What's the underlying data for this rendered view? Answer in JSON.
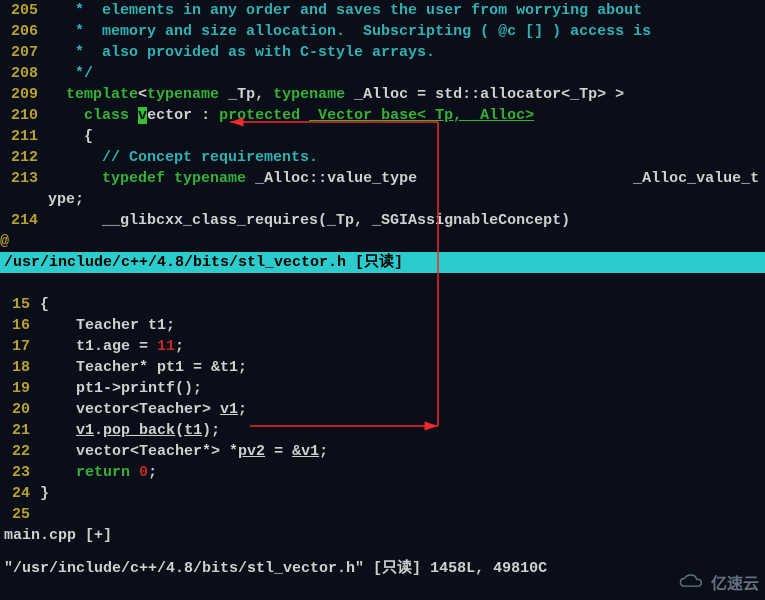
{
  "upper_pane": {
    "lines": [
      {
        "num": "205",
        "segments": [
          {
            "cls": "comment",
            "t": "   *  elements in any order and saves the user from worrying about"
          }
        ]
      },
      {
        "num": "206",
        "segments": [
          {
            "cls": "comment",
            "t": "   *  memory and size allocation.  Subscripting ( @c [] ) access is"
          }
        ]
      },
      {
        "num": "207",
        "segments": [
          {
            "cls": "comment",
            "t": "   *  also provided as with C-style arrays."
          }
        ]
      },
      {
        "num": "208",
        "segments": [
          {
            "cls": "comment",
            "t": "   */"
          }
        ]
      },
      {
        "num": "209",
        "segments": [
          {
            "cls": "plain",
            "t": "  "
          },
          {
            "cls": "keyword",
            "t": "template"
          },
          {
            "cls": "plain",
            "t": "<"
          },
          {
            "cls": "keyword",
            "t": "typename"
          },
          {
            "cls": "plain",
            "t": " _Tp, "
          },
          {
            "cls": "keyword",
            "t": "typename"
          },
          {
            "cls": "plain",
            "t": " _Alloc = std::allocator<_Tp> >"
          }
        ]
      },
      {
        "num": "210",
        "segments": [
          {
            "cls": "plain",
            "t": "    "
          },
          {
            "cls": "keyword",
            "t": "class"
          },
          {
            "cls": "plain",
            "t": " "
          },
          {
            "cls": "cursor",
            "t": "v"
          },
          {
            "cls": "plain",
            "t": "ector : "
          },
          {
            "cls": "protected-kw",
            "t": "protected"
          },
          {
            "cls": "plain",
            "t": " "
          },
          {
            "cls": "type",
            "t": "_Vector_base<_Tp, _Alloc>"
          }
        ]
      },
      {
        "num": "211",
        "segments": [
          {
            "cls": "plain",
            "t": "    {"
          }
        ]
      },
      {
        "num": "212",
        "segments": [
          {
            "cls": "plain",
            "t": "      "
          },
          {
            "cls": "comment",
            "t": "// Concept requirements."
          }
        ]
      },
      {
        "num": "213",
        "segments": [
          {
            "cls": "plain",
            "t": "      "
          },
          {
            "cls": "keyword",
            "t": "typedef"
          },
          {
            "cls": "plain",
            "t": " "
          },
          {
            "cls": "keyword",
            "t": "typename"
          },
          {
            "cls": "plain",
            "t": " _Alloc::value_type                        _Alloc_value_t"
          }
        ]
      },
      {
        "num": "",
        "segments": [
          {
            "cls": "plain",
            "t": "ype;"
          }
        ],
        "continuation": true
      },
      {
        "num": "214",
        "segments": [
          {
            "cls": "plain",
            "t": "      __glibcxx_class_requires(_Tp, _SGIAssignableConcept)"
          }
        ]
      }
    ],
    "atsign": "@",
    "statusbar": "/usr/include/c++/4.8/bits/stl_vector.h [只读]"
  },
  "lower_pane": {
    "lines": [
      {
        "num": "15",
        "segments": [
          {
            "cls": "plain",
            "t": "{"
          }
        ]
      },
      {
        "num": "16",
        "segments": [
          {
            "cls": "plain",
            "t": "    Teacher t1;"
          }
        ]
      },
      {
        "num": "17",
        "segments": [
          {
            "cls": "plain",
            "t": "    t1.age = "
          },
          {
            "cls": "number",
            "t": "11"
          },
          {
            "cls": "plain",
            "t": ";"
          }
        ]
      },
      {
        "num": "18",
        "segments": [
          {
            "cls": "plain",
            "t": "    Teacher* pt1 = &t1;"
          }
        ]
      },
      {
        "num": "19",
        "segments": [
          {
            "cls": "plain",
            "t": "    pt1->printf();"
          }
        ]
      },
      {
        "num": "20",
        "segments": [
          {
            "cls": "plain",
            "t": "    vector<Teacher> "
          },
          {
            "cls": "ident underline",
            "t": "v1"
          },
          {
            "cls": "plain",
            "t": ";"
          }
        ]
      },
      {
        "num": "21",
        "segments": [
          {
            "cls": "plain",
            "t": "    "
          },
          {
            "cls": "ident underline",
            "t": "v1"
          },
          {
            "cls": "plain",
            "t": "."
          },
          {
            "cls": "ident underline",
            "t": "pop_back"
          },
          {
            "cls": "plain",
            "t": "("
          },
          {
            "cls": "ident underline",
            "t": "t1"
          },
          {
            "cls": "plain",
            "t": ");"
          }
        ]
      },
      {
        "num": "22",
        "segments": [
          {
            "cls": "plain",
            "t": "    vector<Teacher*> *"
          },
          {
            "cls": "ident underline",
            "t": "pv2"
          },
          {
            "cls": "plain",
            "t": " = "
          },
          {
            "cls": "ident underline",
            "t": "&v1"
          },
          {
            "cls": "plain",
            "t": ";"
          }
        ]
      },
      {
        "num": "23",
        "segments": [
          {
            "cls": "plain",
            "t": "    "
          },
          {
            "cls": "keyword",
            "t": "return"
          },
          {
            "cls": "plain",
            "t": " "
          },
          {
            "cls": "number",
            "t": "0"
          },
          {
            "cls": "plain",
            "t": ";"
          }
        ]
      },
      {
        "num": "24",
        "segments": [
          {
            "cls": "plain",
            "t": "}"
          }
        ]
      },
      {
        "num": "25",
        "segments": [
          {
            "cls": "plain",
            "t": ""
          }
        ]
      }
    ],
    "statusbar": "main.cpp [+]"
  },
  "cmdline": "\"/usr/include/c++/4.8/bits/stl_vector.h\" [只读] 1458L, 49810C",
  "watermark": "亿速云"
}
